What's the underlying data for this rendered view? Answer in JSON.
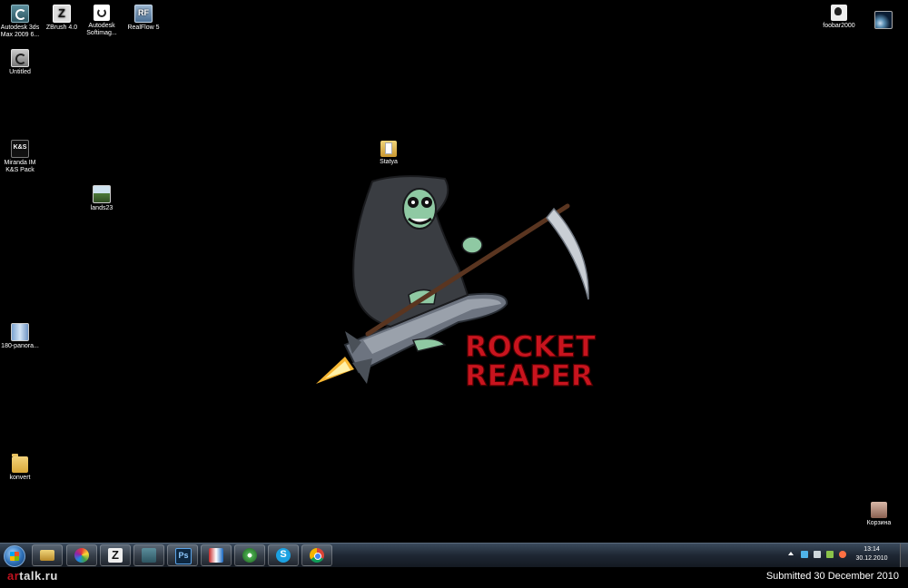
{
  "desktop_icons": [
    {
      "label": "Autodesk 3ds\nMax 2009 6...",
      "icon": "3ds-max-icon"
    },
    {
      "label": "ZBrush 4.0",
      "icon": "zbrush-icon"
    },
    {
      "label": "Autodesk\nSoftimag...",
      "icon": "softimage-icon"
    },
    {
      "label": "RealFlow 5",
      "icon": "realflow-icon"
    },
    {
      "label": "Untitled",
      "icon": "max-file-icon"
    },
    {
      "label": "Miranda IM\nK&S Pack",
      "icon": "miranda-icon"
    },
    {
      "label": "lands23",
      "icon": "image-file-icon"
    },
    {
      "label": "Statya",
      "icon": "folder-document-icon"
    },
    {
      "label": "180-panora...",
      "icon": "panorama-image-icon"
    },
    {
      "label": "konvert",
      "icon": "folder-icon"
    },
    {
      "label": "foobar2000",
      "icon": "foobar-icon"
    },
    {
      "label": "",
      "icon": "space-image-icon"
    },
    {
      "label": "Корзина",
      "icon": "recycle-bin-icon"
    }
  ],
  "wallpaper": {
    "text_line1": "ROCKET",
    "text_line2": "REAPER",
    "text_color": "#c8141e"
  },
  "taskbar": {
    "buttons": [
      {
        "icon": "windows-explorer-icon"
      },
      {
        "icon": "picasa-icon"
      },
      {
        "icon": "zbrush-icon"
      },
      {
        "icon": "3ds-max-icon"
      },
      {
        "icon": "photoshop-icon"
      },
      {
        "icon": "opera-icon"
      },
      {
        "icon": "icq-icon"
      },
      {
        "icon": "skype-icon"
      },
      {
        "icon": "chrome-icon"
      }
    ],
    "clock_time": "13:14",
    "clock_date": "30.12.2010"
  },
  "footer": {
    "logo_prefix": "ar",
    "logo_rest": "talk.ru",
    "submitted": "Submitted 30 December 2010"
  }
}
